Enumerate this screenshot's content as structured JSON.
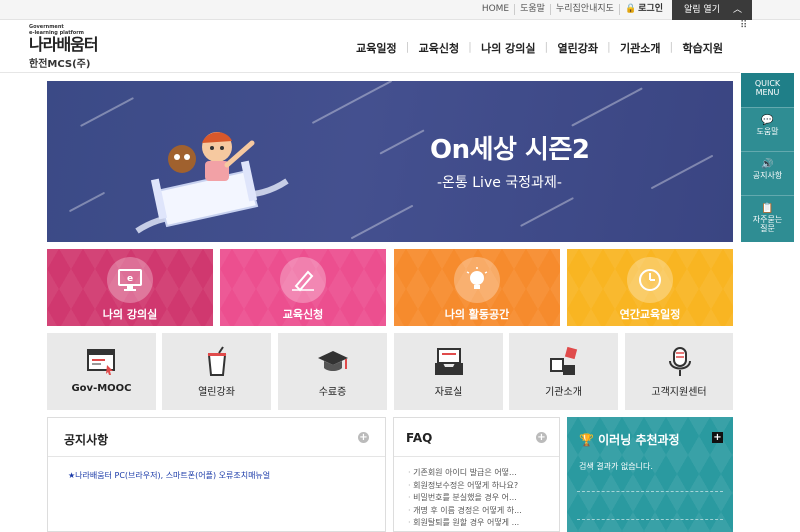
{
  "toplinks": {
    "home": "HOME",
    "help": "도움말",
    "sitemap": "누리집안내지도",
    "login": "로그인",
    "alarm": "알림 열기"
  },
  "logo": {
    "small1": "Government",
    "small2": "e-learning platform",
    "name": "나라배움터",
    "company": "한전MCS(주)"
  },
  "nav": [
    "교육일정",
    "교육신청",
    "나의 강의실",
    "열린강좌",
    "기관소개",
    "학습지원"
  ],
  "banner": {
    "title": "On세상 시즌2",
    "subtitle": "-온통 Live 국정과제-"
  },
  "tiles": [
    {
      "label": "나의 강의실",
      "color": "#d0386f"
    },
    {
      "label": "교육신청",
      "color": "#ec4f8f"
    },
    {
      "label": "나의 활동공간",
      "color": "#f68b2d"
    },
    {
      "label": "연간교육일정",
      "color": "#f9b522"
    }
  ],
  "gray_tiles": [
    "Gov-MOOC",
    "열린강좌",
    "수료증",
    "자료실",
    "기관소개",
    "고객지원센터"
  ],
  "notice": {
    "title": "공지사항",
    "items": [
      "★나라배움터 PC(브라우저), 스마트폰(어플) 오류조치매뉴얼"
    ]
  },
  "faq": {
    "title": "FAQ",
    "items": [
      "기존회원 아이디 발급은 어떻...",
      "회원정보수정은 어떻게 하나요?",
      "비밀번호를 분실했을 경우 어...",
      "개명 후 이름 경정은 어떻게 하...",
      "회원탈퇴를 원할 경우 어떻게 ..."
    ]
  },
  "recommend": {
    "title": "이러닝 추천과정",
    "empty": "검색 결과가 없습니다."
  },
  "quick": {
    "head1": "QUICK",
    "head2": "MENU",
    "items": [
      {
        "label": "도움말"
      },
      {
        "label": "공지사항"
      },
      {
        "label1": "자주묻는",
        "label2": "질문"
      }
    ]
  }
}
